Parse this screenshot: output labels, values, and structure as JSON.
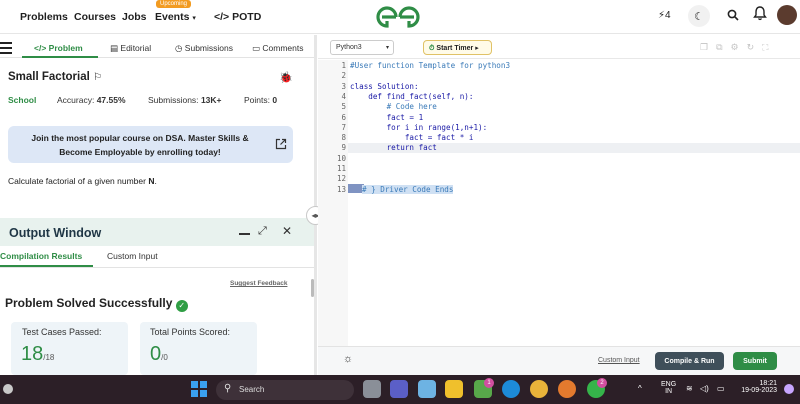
{
  "nav": {
    "problems": "Problems",
    "courses": "Courses",
    "jobs": "Jobs",
    "events": "Events",
    "events_badge": "Upcoming",
    "potd": "POTD",
    "potd_icon": "</>",
    "logo": "GfG",
    "streak_count": "4"
  },
  "tabs": {
    "problem": "Problem",
    "editorial": "Editorial",
    "submissions": "Submissions",
    "comments": "Comments"
  },
  "problem": {
    "title": "Small Factorial",
    "difficulty": "School",
    "accuracy_label": "Accuracy:",
    "accuracy": "47.55%",
    "submissions_label": "Submissions:",
    "submissions": "13K+",
    "points_label": "Points:",
    "points": "0",
    "promo": "Join the most popular course on DSA. Master Skills & Become Employable by enrolling today!",
    "description_prefix": "Calculate factorial of a given number ",
    "description_var": "N",
    "description_suffix": "."
  },
  "output": {
    "title": "Output Window",
    "tab_results": "Compilation Results",
    "tab_custom": "Custom Input",
    "suggest": "Suggest Feedback",
    "status": "Problem Solved Successfully",
    "tests_label": "Test Cases Passed:",
    "tests_passed": "18",
    "tests_total": "/18",
    "points_label": "Total Points Scored:",
    "points_scored": "0",
    "points_total": "/0"
  },
  "editor": {
    "language": "Python3",
    "timer": "Start Timer",
    "line_numbers": [
      "1",
      "2",
      "3",
      "4",
      "5",
      "6",
      "7",
      "8",
      "9",
      "10",
      "11",
      "12",
      "13"
    ],
    "lines": [
      "#User function Template for python3",
      "",
      "class Solution:",
      "    def find_fact(self, n):",
      "        # Code here",
      "        fact = 1",
      "        for i in range(1,n+1):",
      "            fact = fact * i",
      "        return fact",
      "",
      "",
      "",
      "# } Driver Code Ends"
    ],
    "custom_input": "Custom Input",
    "compile_run": "Compile & Run",
    "submit": "Submit"
  },
  "taskbar": {
    "search": "Search",
    "lang_top": "ENG",
    "lang_bottom": "IN",
    "time": "18:21",
    "date": "19-09-2023",
    "badge_1": "1",
    "badge_2": "2"
  },
  "colors": {
    "accent": "#2f8d46",
    "compile": "#3f4f5a",
    "taskbar": "#2c1f27"
  }
}
